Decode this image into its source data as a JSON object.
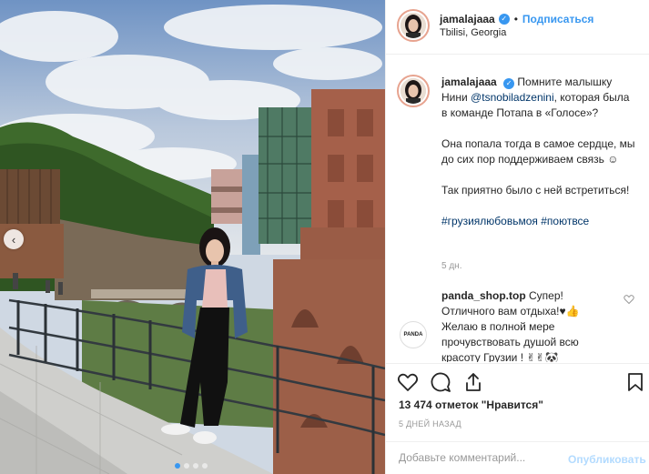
{
  "header": {
    "username": "jamalajaaa",
    "verified_mark": "✓",
    "separator": "•",
    "follow_label": "Подписаться",
    "location": "Tbilisi, Georgia"
  },
  "caption": {
    "username": "jamalajaaa",
    "verified_mark": "✓",
    "text_a": "Помните малышку Нини",
    "mention": "@tsnobiladzenini",
    "text_b": ", которая была в команде Потапа в «Голосе»?",
    "para2": "Она попала тогда в самое сердце, мы до сих пор поддерживаем связь ☺",
    "para3": "Так приятно было с ней встретиться!",
    "hashtag1": "#грузиялюбовьмоя",
    "hashtag2": "#поютвсе",
    "time": "5 дн."
  },
  "comment": {
    "username": "panda_shop.top",
    "text": "Супер! Отличного вам отдыха!♥👍 Желаю в полной мере прочувствовать душой всю красоту Грузии ! ✌✌🐼",
    "avatar_label": "PANDA"
  },
  "actions": {
    "like_icon": "heart-icon",
    "comment_icon": "comment-icon",
    "share_icon": "share-icon",
    "save_icon": "bookmark-icon"
  },
  "likes": "13 474 отметок \"Нравится\"",
  "post_time": "5 ДНЕЙ НАЗАД",
  "add_comment": {
    "placeholder": "Добавьте комментарий...",
    "publish_label": "Опубликовать"
  },
  "carousel": {
    "prev_arrow": "‹",
    "slide_count": 4,
    "active_index": 0
  },
  "colors": {
    "link": "#3897f0",
    "hashtag": "#003569",
    "publish_disabled": "#b3dbff",
    "muted": "#999999"
  }
}
